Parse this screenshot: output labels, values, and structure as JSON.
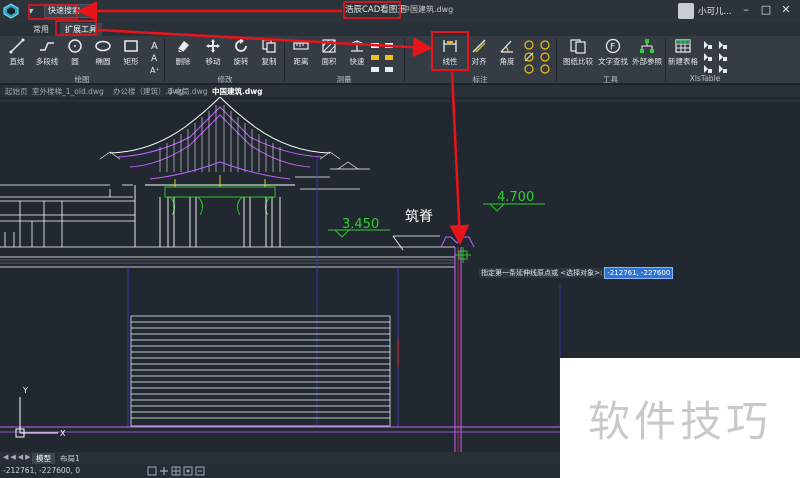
{
  "window": {
    "title": "浩辰CAD看图王",
    "file": "中国建筑.dwg",
    "user": "小可儿...",
    "quick_search": "快速搜索",
    "controls": [
      "–",
      "□",
      "✕"
    ]
  },
  "menu": {
    "tabs": [
      {
        "label": "常用",
        "active": false
      },
      {
        "label": "扩展工具",
        "active": true
      }
    ]
  },
  "ribbon": {
    "buttons": {
      "line": "直线",
      "polyline": "多段线",
      "circle": "圆",
      "ellipse": "椭圆",
      "rect": "矩形",
      "delete": "删除",
      "move": "移动",
      "rotate": "旋转",
      "copy": "复制",
      "distance": "距离",
      "area": "面积",
      "quick": "快速",
      "linear": "线性",
      "aligned": "对齐",
      "angle": "角度",
      "compare": "图纸比较",
      "find_text": "文字查找",
      "xref": "外部参照",
      "new_table": "新建表格"
    },
    "groups": {
      "draw": "绘图",
      "modify": "修改",
      "measure": "测量",
      "dimension": "标注",
      "tools": "工具",
      "xlstable": "XlsTable"
    }
  },
  "document_tabs": [
    {
      "label": "起始页",
      "active": false
    },
    {
      "label": "室外楼梯_1_old.dwg",
      "active": false
    },
    {
      "label": "办公楼（建筑）.dwg",
      "active": false
    },
    {
      "label": "手电筒.dwg",
      "active": false
    },
    {
      "label": "中国建筑.dwg",
      "active": true
    }
  ],
  "drawing": {
    "elevation_1": "3.450",
    "elevation_2": "4.700",
    "ridge_label": "筑脊",
    "axis_y": "Y",
    "axis_x": "X"
  },
  "command": {
    "prompt": "指定第一条延伸线原点或 <选择对象>:",
    "input_value": "-212761, -227600"
  },
  "layout_tabs": [
    {
      "label": "模型",
      "active": true
    },
    {
      "label": "布局1",
      "active": false
    }
  ],
  "status": {
    "coords": "-212761, -227600, 0"
  },
  "watermark": "软件技巧",
  "colors": {
    "annotation_red": "#e8141b",
    "canvas_bg": "#212830",
    "cad_white": "#ffffff",
    "cad_magenta": "#c060ff",
    "cad_green": "#2fd02f",
    "cad_yellow": "#e6e022",
    "cad_red": "#e03030",
    "cad_blue": "#3a3ac8"
  }
}
